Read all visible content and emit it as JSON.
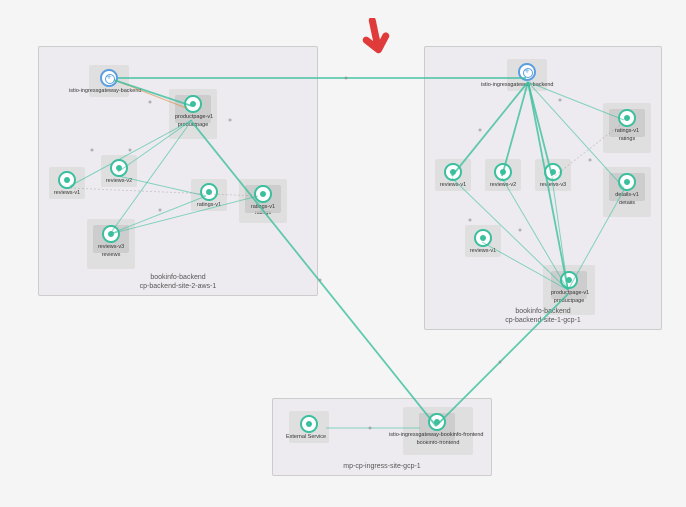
{
  "clusters": {
    "left": {
      "name": "bookinfo-backend",
      "subtitle": "cp-backend-site-2-aws-1",
      "nodes": {
        "ingress": "istio-ingressgateway-backend",
        "productpage": "productpage",
        "productpage_v": "productpage-v1",
        "reviews_v1": "reviews-v1",
        "reviews_v2": "reviews-v2",
        "reviews_v3": "reviews-v3",
        "reviews": "reviews",
        "ratings_v1": "ratings-v1",
        "ratings": "ratings"
      }
    },
    "right": {
      "name": "bookinfo-backend",
      "subtitle": "cp-backend-site-1-gcp-1",
      "nodes": {
        "ingress": "istio-ingressgateway-backend",
        "ratings_v1": "ratings-v1",
        "ratings": "ratings",
        "reviews_v1": "reviews-v1",
        "reviews_v2": "reviews-v2",
        "reviews_v3": "reviews-v3",
        "details_v1": "details-v1",
        "details": "details",
        "productpage_v": "productpage-v1",
        "productpage": "productpage"
      }
    },
    "bottom": {
      "name": "",
      "subtitle": "mp-cp-ingress-site-gcp-1",
      "nodes": {
        "external": "External Service",
        "ingress": "istio-ingressgateway-bookinfo-frontend",
        "frontend": "bookinfo-frontend"
      }
    }
  },
  "arrow_note": "→"
}
